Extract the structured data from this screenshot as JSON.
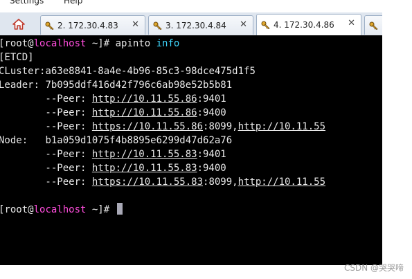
{
  "menubar": {
    "items": [
      "Settings",
      "Help"
    ]
  },
  "tabs": [
    {
      "label": "2. 172.30.4.83",
      "active": false,
      "has_close": true
    },
    {
      "label": "3. 172.30.4.84",
      "active": false,
      "has_close": true
    },
    {
      "label": "4. 172.30.4.86",
      "active": true,
      "has_close": true
    }
  ],
  "tab_close_glyph": "✕",
  "terminal": {
    "prompt_user": "root@",
    "prompt_host": "localhost",
    "prompt_path": " ~]# ",
    "prompt_open": "[",
    "command": "apinto",
    "command_arg": "info",
    "section": "[ETCD]",
    "cluster_label": "CLuster:",
    "cluster_id": "a63e8841-8a4e-4b96-85c3-98dce475d1f5",
    "leader_label": "Leader: ",
    "leader_id": "7b095ddf416d42f796c6ab98e52b5b81",
    "node_label": "Node:   ",
    "node_id": "b1a059d1075f4b8895e6299d47d62a76",
    "peer_prefix": "        --Peer: ",
    "leader_peers": [
      {
        "url": "http://10.11.55.86",
        "suffix": ":9401"
      },
      {
        "url": "http://10.11.55.86",
        "suffix": ":9400"
      },
      {
        "url": "https://10.11.55.86",
        "suffix": ":8099,",
        "url2": "http://10.11.55"
      }
    ],
    "node_peers": [
      {
        "url": "http://10.11.55.83",
        "suffix": ":9401"
      },
      {
        "url": "http://10.11.55.83",
        "suffix": ":9400"
      },
      {
        "url": "https://10.11.55.83",
        "suffix": ":8099,",
        "url2": "http://10.11.55"
      }
    ],
    "final_prompt_path": " ~]# "
  },
  "watermark": "CSDN @哭哭啼",
  "colors": {
    "host": "#ff4ddc",
    "command_arg": "#3fd8ff",
    "terminal_bg": "#000000",
    "tabbar_bg": "#dfe6ef"
  },
  "icons": {
    "home": "home-icon",
    "tab": "key-icon",
    "close": "close-icon"
  }
}
